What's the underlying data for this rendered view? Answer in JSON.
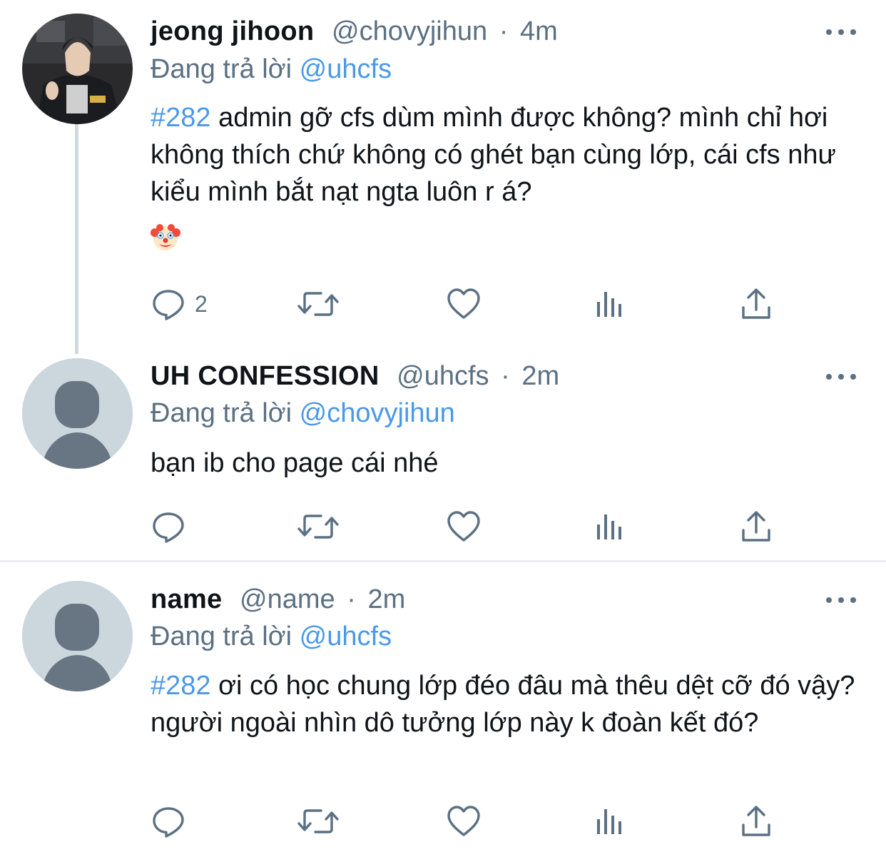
{
  "tweets": [
    {
      "name": "jeong jihoon",
      "handle": "@chovyjihun",
      "sep": "·",
      "time": "4m",
      "replying_prefix": "Đang trả lời",
      "replying_to": "@uhcfs",
      "hashtag": "#282",
      "text": " admin gỡ cfs dùm mình được không? mình chỉ hơi không thích chứ không có ghét bạn cùng lớp, cái cfs như kiểu mình bắt nạt ngta luôn r á?",
      "emoji": "clown-face-emoji",
      "reply_count": "2",
      "avatar": "photo"
    },
    {
      "name": "UH CONFESSION",
      "handle": "@uhcfs",
      "sep": "·",
      "time": "2m",
      "replying_prefix": "Đang trả lời",
      "replying_to": "@chovyjihun",
      "text": "bạn ib cho page cái nhé",
      "reply_count": "",
      "avatar": "default"
    },
    {
      "name": "name",
      "handle": "@name",
      "sep": "·",
      "time": "2m",
      "replying_prefix": "Đang trả lời",
      "replying_to": "@uhcfs",
      "hashtag": "#282",
      "text": " ơi có học chung lớp đéo đâu mà thêu dệt cỡ đó vậy? người ngoài nhìn dô tưởng lớp này k đoàn kết đó?",
      "reply_count": "",
      "avatar": "default"
    }
  ],
  "icons": {
    "reply": "reply-icon",
    "retweet": "retweet-icon",
    "like": "like-icon",
    "analytics": "analytics-icon",
    "share": "share-icon",
    "more": "more-icon"
  },
  "colors": {
    "link": "#4a99e9",
    "muted": "#5b7083",
    "text": "#0f1419",
    "avatar_default": "#ccd6dd",
    "avatar_silhouette": "#687684"
  }
}
